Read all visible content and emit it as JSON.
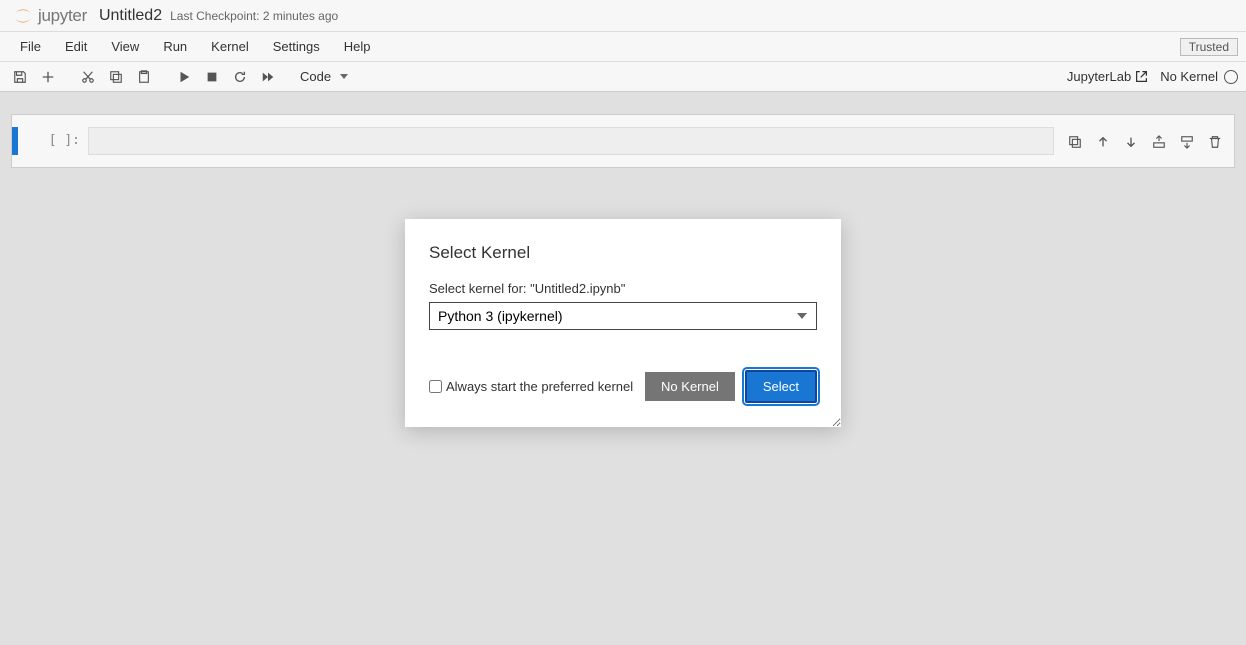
{
  "header": {
    "logo_text": "jupyter",
    "notebook_title": "Untitled2",
    "checkpoint": "Last Checkpoint: 2 minutes ago"
  },
  "menubar": {
    "items": [
      "File",
      "Edit",
      "View",
      "Run",
      "Kernel",
      "Settings",
      "Help"
    ],
    "trusted": "Trusted"
  },
  "toolbar": {
    "cell_type": "Code",
    "jupyterlab": "JupyterLab",
    "kernel": "No Kernel"
  },
  "cell": {
    "prompt": "[ ]:"
  },
  "modal": {
    "title": "Select Kernel",
    "label": "Select kernel for: \"Untitled2.ipynb\"",
    "selected": "Python 3 (ipykernel)",
    "checkbox_label": "Always start the preferred kernel",
    "no_kernel_btn": "No Kernel",
    "select_btn": "Select"
  }
}
